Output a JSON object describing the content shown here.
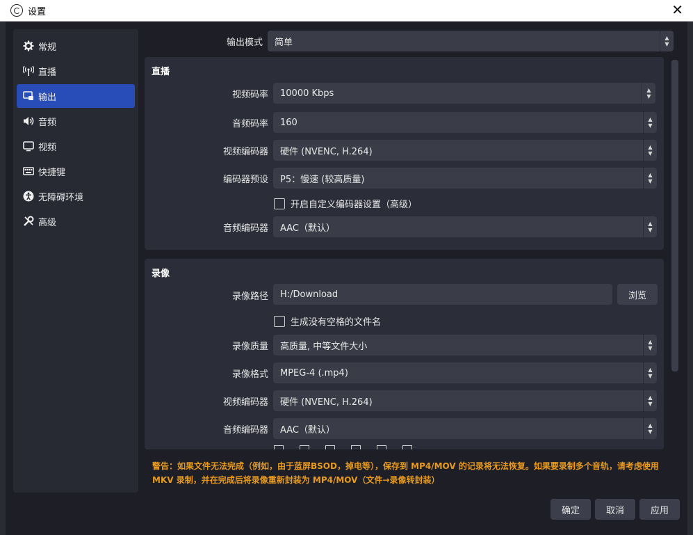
{
  "window": {
    "title": "设置"
  },
  "sidebar": {
    "items": [
      {
        "label": "常规",
        "icon": "gear-icon"
      },
      {
        "label": "直播",
        "icon": "broadcast-icon"
      },
      {
        "label": "输出",
        "icon": "output-icon",
        "active": true
      },
      {
        "label": "音频",
        "icon": "speaker-icon"
      },
      {
        "label": "视频",
        "icon": "monitor-icon"
      },
      {
        "label": "快捷键",
        "icon": "keyboard-icon"
      },
      {
        "label": "无障碍环境",
        "icon": "accessibility-icon"
      },
      {
        "label": "高级",
        "icon": "wrench-icon"
      }
    ]
  },
  "output_mode": {
    "label": "输出模式",
    "value": "简单"
  },
  "streaming": {
    "title": "直播",
    "video_bitrate": {
      "label": "视频码率",
      "value": "10000 Kbps"
    },
    "audio_bitrate": {
      "label": "音频码率",
      "value": "160"
    },
    "video_encoder": {
      "label": "视频编码器",
      "value": "硬件 (NVENC, H.264)"
    },
    "encoder_preset": {
      "label": "编码器预设",
      "value": "P5：慢速 (较高质量)"
    },
    "custom_encoder": {
      "label": "开启自定义编码器设置（高级）",
      "checked": false
    },
    "audio_encoder": {
      "label": "音频编码器",
      "value": "AAC（默认）"
    }
  },
  "recording": {
    "title": "录像",
    "path": {
      "label": "录像路径",
      "value": "H:/Download",
      "browse_label": "浏览"
    },
    "no_space": {
      "label": "生成没有空格的文件名",
      "checked": false
    },
    "quality": {
      "label": "录像质量",
      "value": "高质量, 中等文件大小"
    },
    "format": {
      "label": "录像格式",
      "value": "MPEG-4 (.mp4)"
    },
    "video_encoder": {
      "label": "视频编码器",
      "value": "硬件 (NVENC, H.264)"
    },
    "audio_encoder": {
      "label": "音频编码器",
      "value": "AAC（默认）"
    }
  },
  "warning": "警告：如果文件无法完成（例如，由于蓝屏BSOD，掉电等），保存到 MP4/MOV 的记录将无法恢复。如果要录制多个音轨，请考虑使用 MKV 录制，并在完成后将录像重新封装为 MP4/MOV（文件→录像转封装）",
  "buttons": {
    "ok": "确定",
    "cancel": "取消",
    "apply": "应用"
  },
  "colors": {
    "accent": "#284cb8",
    "warning": "#e89a1f",
    "background": "#1e1f26"
  }
}
